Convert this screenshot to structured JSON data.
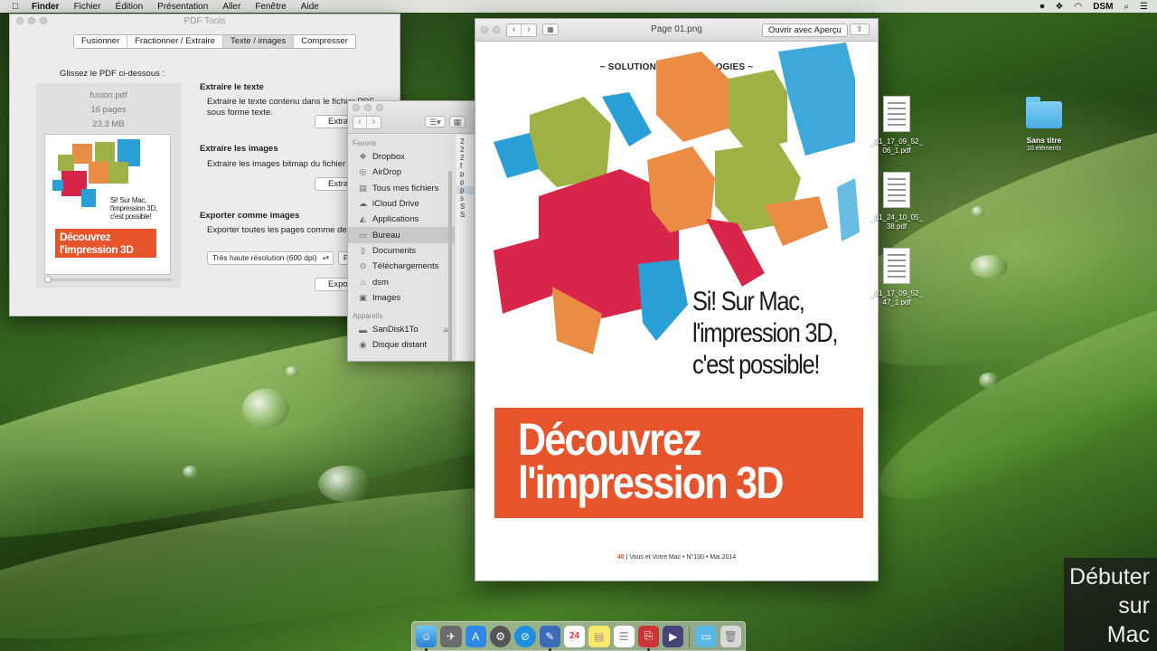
{
  "menubar": {
    "apple": "",
    "items": [
      "Finder",
      "Fichier",
      "Édition",
      "Présentation",
      "Aller",
      "Fenêtre",
      "Aide"
    ],
    "user": "DSM"
  },
  "pdf_tools": {
    "title": "PDF Tools",
    "tabs": [
      "Fusionner",
      "Fractionner / Extraire",
      "Texte / images",
      "Compresser"
    ],
    "selected_tab": "Texte / images",
    "drop_label": "Glissez le PDF ci-dessous :",
    "file_name": "fusion.pdf",
    "file_pages": "16 pages",
    "file_size": "23.3 MB",
    "thumb_text_1": "Si! Sur Mac,\nl'impression 3D,\nc'est possible!",
    "thumb_banner": "Découvrez\nl'impression 3D",
    "sections": {
      "text_title": "Extraire le texte",
      "text_desc": "Extraire le texte contenu dans le fichier PDF sous forme texte.",
      "text_button": "Extraire",
      "images_title": "Extraire les images",
      "images_desc": "Extraire les images bitmap du fichier PDF",
      "images_button": "Extraire",
      "export_title": "Exporter comme images",
      "export_desc": "Exporter toutes les pages comme des",
      "resolution_select": "Très haute résolution (600 dpi)",
      "format_select": "P",
      "export_button": "Exporter"
    }
  },
  "finder": {
    "favorites_header": "Favoris",
    "favorites": [
      "Dropbox",
      "AirDrop",
      "Tous mes fichiers",
      "iCloud Drive",
      "Applications",
      "Bureau",
      "Documents",
      "Téléchargements",
      "dsm",
      "Images"
    ],
    "active_item": "Bureau",
    "devices_header": "Appareils",
    "devices": [
      "SanDisk1To",
      "Disque distant"
    ],
    "list_items": [
      "2",
      "2",
      "2",
      "f",
      "p",
      "p",
      "p",
      "s",
      "S",
      "S"
    ]
  },
  "preview": {
    "title": "Page 01.png",
    "open_button": "Ouvrir avec Aperçu",
    "magazine": {
      "kicker": "~ SOLUTIONS | TECHNOLOGIES ~",
      "line1": "Si! Sur Mac,",
      "line2": "l'impression 3D,",
      "line3": "c'est possible!",
      "banner1": "Découvrez",
      "banner2": "l'impression 3D",
      "footer_num": "40",
      "footer_text": "| Vous et Votre Mac • N°100 • Mai 2014"
    }
  },
  "desktop_icons": [
    {
      "name": "_01_17_09_52_\n06_1.pdf"
    },
    {
      "name": "_01_24_10_05_\n38.pdf"
    },
    {
      "name": "_01_17_09_52_\n47_1.pdf"
    },
    {
      "name": "Sans titre",
      "sub": "10 éléments"
    }
  ],
  "watermark": {
    "line1": "Débuter",
    "line2": "sur",
    "line3": "Mac"
  },
  "dock": {
    "calendar_day": "24"
  },
  "colors": {
    "accent_orange": "#e5542b",
    "cube_red": "#d8254a",
    "cube_blue": "#2a9fd6",
    "cube_green": "#9fb045",
    "cube_orange": "#eb8c45"
  }
}
